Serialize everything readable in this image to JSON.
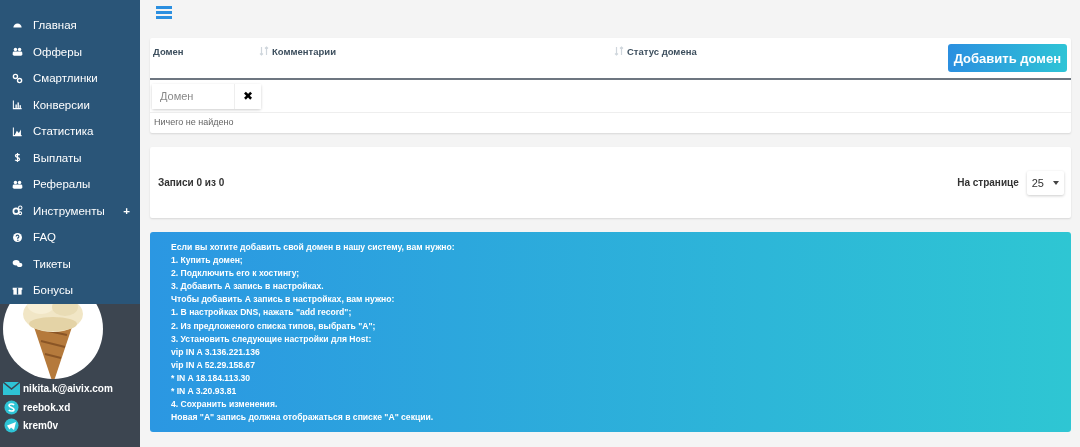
{
  "sidebar": {
    "items": [
      {
        "label": "Главная",
        "selected": false
      },
      {
        "label": "Офферы",
        "selected": false
      },
      {
        "label": "Смартлинки",
        "selected": false
      },
      {
        "label": "Конверсии",
        "selected": false
      },
      {
        "label": "Статистика",
        "selected": false
      },
      {
        "label": "Выплаты",
        "selected": false
      },
      {
        "label": "Рефералы",
        "selected": false
      },
      {
        "label": "Инструменты",
        "selected": false,
        "toggle": "+"
      },
      {
        "label": "FAQ",
        "selected": false
      },
      {
        "label": "Тикеты",
        "selected": false
      },
      {
        "label": "Бонусы",
        "selected": false
      }
    ],
    "contacts": [
      {
        "kind": "email",
        "text": "nikita.k@aivix.com"
      },
      {
        "kind": "skype",
        "text": "reebok.xd"
      },
      {
        "kind": "telegram",
        "text": "krem0v"
      }
    ]
  },
  "table": {
    "columns": [
      {
        "label": "Домен",
        "sort_icon": false
      },
      {
        "label": "Комментарии",
        "sort_icon": true
      },
      {
        "label": "Статус домена",
        "sort_icon": true
      }
    ],
    "add_button": "Добавить домен",
    "filter": {
      "placeholder": "Домен",
      "clear": "✖"
    },
    "empty_message": "Ничего не найдено"
  },
  "pager": {
    "records": "Записи 0 из 0",
    "per_page_label": "На странице",
    "per_page": "25"
  },
  "info": {
    "lines": [
      "Если вы хотите добавить свой домен в нашу систему, вам нужно:",
      "1. Купить домен;",
      "2. Подключить его к хостингу;",
      "3. Добавить А запись в настройках.",
      "Чтобы добавить А запись в настройках, вам нужно:",
      "1. В настройках DNS, нажать \"add record\";",
      "2. Из предложеного списка типов, выбрать \"А\";",
      "3. Установить следующие настройки для Host:",
      "vip IN A 3.136.221.136",
      "vip IN A 52.29.158.67",
      "* IN A 18.184.113.30",
      "* IN A 3.20.93.81",
      "4. Сохранить изменения.",
      "Новая \"А\" запись должна отображаться в списке \"А\" секции."
    ]
  }
}
